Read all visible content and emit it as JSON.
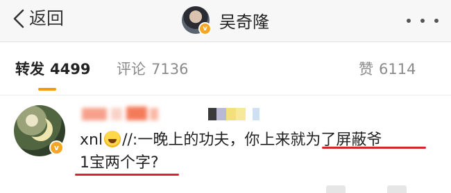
{
  "nav": {
    "back_label": "返回",
    "title": "吴奇隆",
    "verified_mark": "v"
  },
  "tabs": [
    {
      "label": "转发",
      "count": "4499"
    },
    {
      "label": "评论",
      "count": "7136"
    },
    {
      "label": "赞",
      "count": "6114"
    }
  ],
  "post": {
    "verified_mark": "v",
    "line1_prefix": "xnl",
    "line1_rest": "//:一晚上的功夫，你上来",
    "line1_underlined": "就为了屏蔽爷",
    "line2": "1宝两个字?"
  },
  "colors": {
    "accent": "#f39a12",
    "underline_red": "#d9232a",
    "verified": "#f5a623"
  },
  "icons": {
    "back": "chevron-left-icon",
    "more": "more-dots-icon",
    "emoji": "rofl-emoji-icon"
  }
}
